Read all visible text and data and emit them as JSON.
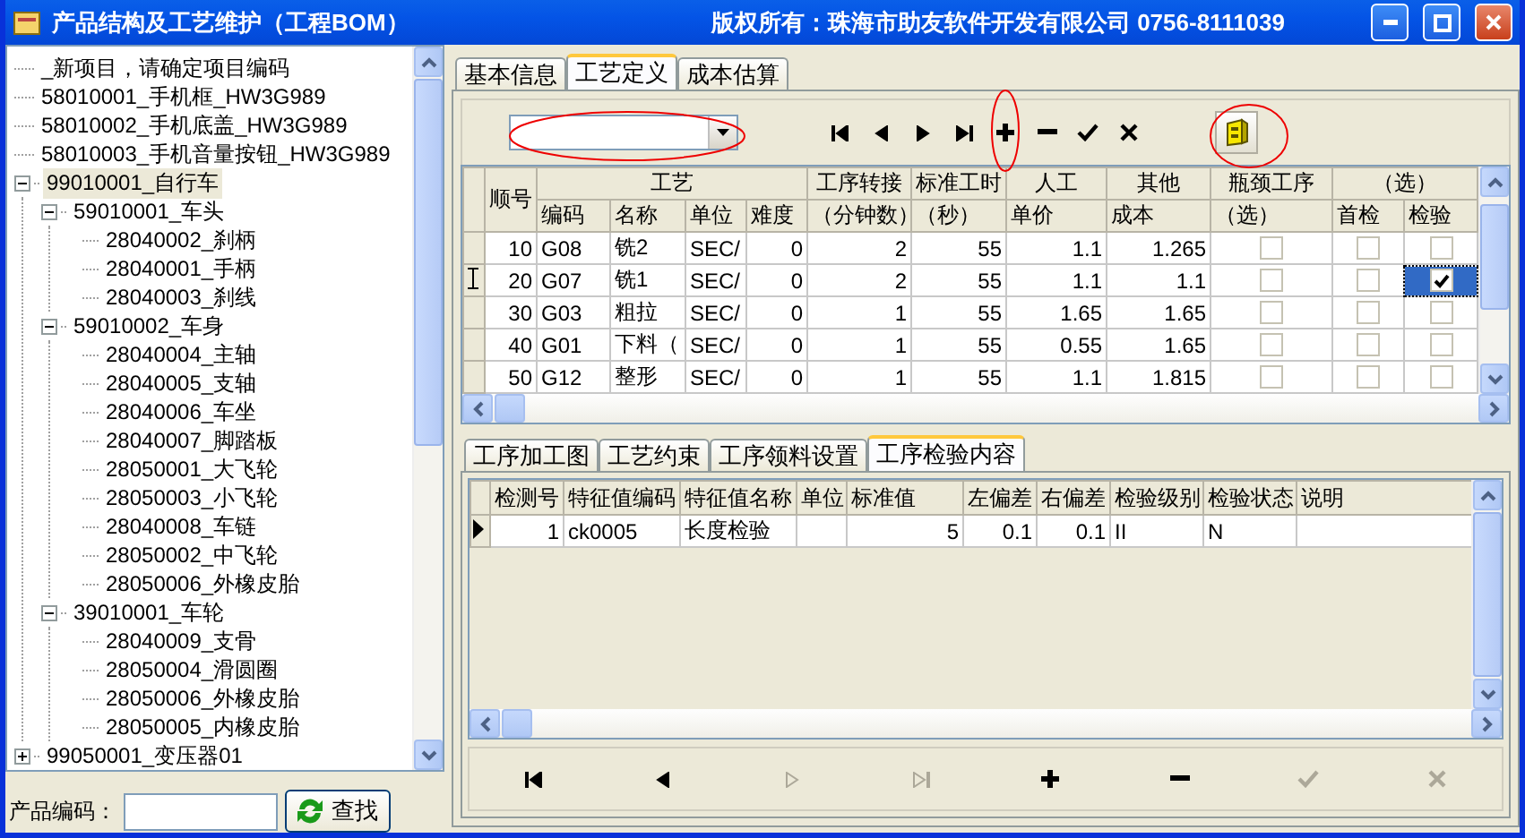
{
  "window": {
    "title": "产品结构及工艺维护（工程BOM）",
    "copyright": "版权所有：珠海市助友软件开发有限公司  0756-8111039"
  },
  "tree": [
    {
      "label": "_新项目，请确定项目编码",
      "selected": false
    },
    {
      "label": "58010001_手机框_HW3G989",
      "selected": false
    },
    {
      "label": "58010002_手机底盖_HW3G989",
      "selected": false
    },
    {
      "label": "58010003_手机音量按钮_HW3G989",
      "selected": false
    },
    {
      "label": "99010001_自行车",
      "selected": true,
      "expanded": true,
      "children": [
        {
          "label": "59010001_车头",
          "selected": false,
          "expanded": true,
          "children": [
            {
              "label": "28040002_刹柄",
              "selected": false
            },
            {
              "label": "28040001_手柄",
              "selected": false
            },
            {
              "label": "28040003_刹线",
              "selected": false
            }
          ]
        },
        {
          "label": "59010002_车身",
          "selected": false,
          "expanded": true,
          "children": [
            {
              "label": "28040004_主轴",
              "selected": false
            },
            {
              "label": "28040005_支轴",
              "selected": false
            },
            {
              "label": "28040006_车坐",
              "selected": false
            },
            {
              "label": "28040007_脚踏板",
              "selected": false
            },
            {
              "label": "28050001_大飞轮",
              "selected": false
            },
            {
              "label": "28050003_小飞轮",
              "selected": false
            },
            {
              "label": "28040008_车链",
              "selected": false
            },
            {
              "label": "28050002_中飞轮",
              "selected": false
            },
            {
              "label": "28050006_外橡皮胎",
              "selected": false
            }
          ]
        },
        {
          "label": "39010001_车轮",
          "selected": false,
          "expanded": true,
          "children": [
            {
              "label": "28040009_支骨",
              "selected": false
            },
            {
              "label": "28050004_滑圆圈",
              "selected": false
            },
            {
              "label": "28050006_外橡皮胎",
              "selected": false
            },
            {
              "label": "28050005_内橡皮胎",
              "selected": false
            }
          ]
        }
      ]
    },
    {
      "label": "99050001_变压器01",
      "selected": false,
      "expanded": false
    }
  ],
  "search": {
    "label": "产品编码：",
    "button": "查找"
  },
  "tabs": [
    {
      "label": "基本信息",
      "selected": false
    },
    {
      "label": "工艺定义",
      "selected": true
    },
    {
      "label": "成本估算",
      "selected": false
    }
  ],
  "toolbar": [
    {
      "kind": "first",
      "disabled": false
    },
    {
      "kind": "prev",
      "disabled": false
    },
    {
      "kind": "next",
      "disabled": false
    },
    {
      "kind": "last",
      "disabled": false
    },
    {
      "kind": "add",
      "disabled": false
    },
    {
      "kind": "delete",
      "disabled": false
    },
    {
      "kind": "confirm",
      "disabled": false
    },
    {
      "kind": "cancel",
      "disabled": false
    }
  ],
  "process_grid": {
    "groups": [
      {
        "label": "顺号"
      },
      {
        "label": "工艺",
        "columns": [
          "编码",
          "名称",
          "单位",
          "难度"
        ]
      },
      {
        "label": "工序转接",
        "columns": [
          "（分钟数）"
        ]
      },
      {
        "label": "标准工时",
        "columns": [
          "（秒）"
        ]
      },
      {
        "label": "人工",
        "columns": [
          "单价"
        ]
      },
      {
        "label": "其他",
        "columns": [
          "成本"
        ]
      },
      {
        "label": "瓶颈工序",
        "columns": [
          "（选）"
        ]
      },
      {
        "label": "（选）",
        "columns": [
          "首检",
          "检验"
        ]
      }
    ],
    "rows": [
      {
        "selected": false,
        "cells": [
          "10",
          "G08",
          "铣2",
          "SEC/",
          "0",
          "2",
          "55",
          "1.1",
          "1.265"
        ],
        "bottleneck": false,
        "first_check": false,
        "inspect": false
      },
      {
        "selected": true,
        "cells": [
          "20",
          "G07",
          "铣1",
          "SEC/",
          "0",
          "2",
          "55",
          "1.1",
          "1.1"
        ],
        "bottleneck": false,
        "first_check": false,
        "inspect": true
      },
      {
        "selected": false,
        "cells": [
          "30",
          "G03",
          "粗拉",
          "SEC/",
          "0",
          "1",
          "55",
          "1.65",
          "1.65"
        ],
        "bottleneck": false,
        "first_check": false,
        "inspect": false
      },
      {
        "selected": false,
        "cells": [
          "40",
          "G01",
          "下料（",
          "SEC/",
          "0",
          "1",
          "55",
          "0.55",
          "1.65"
        ],
        "bottleneck": false,
        "first_check": false,
        "inspect": false
      },
      {
        "selected": false,
        "cells": [
          "50",
          "G12",
          "整形",
          "SEC/",
          "0",
          "1",
          "55",
          "1.1",
          "1.815"
        ],
        "bottleneck": false,
        "first_check": false,
        "inspect": false
      }
    ]
  },
  "sub_tabs": [
    {
      "label": "工序加工图",
      "selected": false
    },
    {
      "label": "工艺约束",
      "selected": false
    },
    {
      "label": "工序领料设置",
      "selected": false
    },
    {
      "label": "工序检验内容",
      "selected": true
    }
  ],
  "inspection_grid": {
    "columns": [
      "检测号",
      "特征值编码",
      "特征值名称",
      "单位",
      "标准值",
      "左偏差",
      "右偏差",
      "检验级别",
      "检验状态",
      "说明"
    ],
    "rows": [
      {
        "selected": true,
        "cells": [
          "1",
          "ck0005",
          "长度检验",
          null,
          "5",
          "0.1",
          "0.1",
          "II",
          "N",
          null
        ]
      }
    ]
  },
  "nav_bar": [
    {
      "kind": "first",
      "disabled": false
    },
    {
      "kind": "prev",
      "disabled": false
    },
    {
      "kind": "next",
      "disabled": true
    },
    {
      "kind": "last",
      "disabled": true
    },
    {
      "kind": "add",
      "disabled": false
    },
    {
      "kind": "delete",
      "disabled": false
    },
    {
      "kind": "confirm",
      "disabled": true
    },
    {
      "kind": "cancel",
      "disabled": true
    }
  ]
}
